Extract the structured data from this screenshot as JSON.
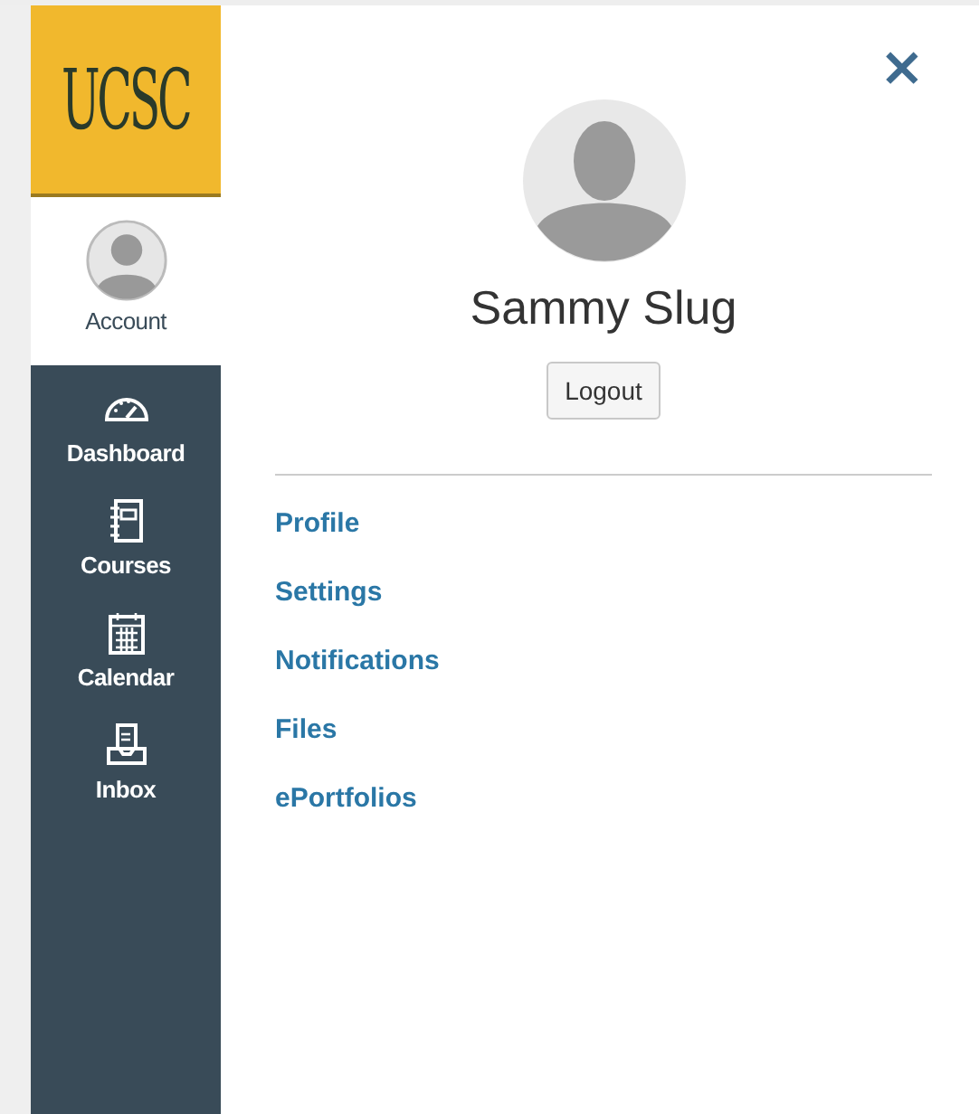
{
  "logo": {
    "text": "UCSC"
  },
  "nav": [
    {
      "label": "Account",
      "kind": "avatar",
      "selected": true
    },
    {
      "label": "Dashboard",
      "kind": "gauge",
      "selected": false
    },
    {
      "label": "Courses",
      "kind": "notebook",
      "selected": false
    },
    {
      "label": "Calendar",
      "kind": "calendar",
      "selected": false
    },
    {
      "label": "Inbox",
      "kind": "inbox",
      "selected": false
    }
  ],
  "panel": {
    "close": "×",
    "name": "Sammy Slug",
    "logout": "Logout",
    "links": [
      "Profile",
      "Settings",
      "Notifications",
      "Files",
      "ePortfolios"
    ]
  }
}
